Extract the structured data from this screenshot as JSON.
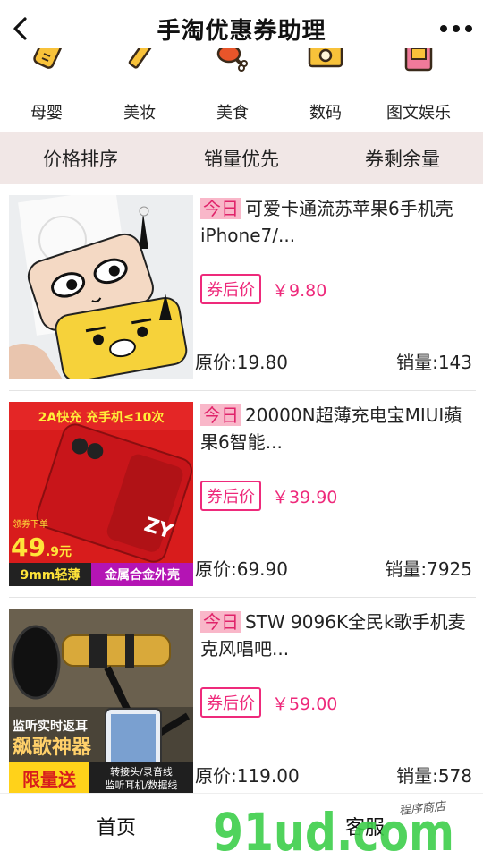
{
  "header": {
    "title": "手淘优惠券助理"
  },
  "categories": [
    {
      "label": "母婴",
      "icon": "baby-bottle-icon"
    },
    {
      "label": "美妆",
      "icon": "lipstick-icon"
    },
    {
      "label": "美食",
      "icon": "drumstick-icon"
    },
    {
      "label": "数码",
      "icon": "camera-icon"
    },
    {
      "label": "图文娱乐",
      "icon": "book-icon"
    }
  ],
  "sort": {
    "price": "价格排序",
    "sales": "销量优先",
    "coupon_left": "券剩余量"
  },
  "products": [
    {
      "today": "今日",
      "title": "可爱卡通流苏苹果6手机壳iPhone7/...",
      "coupon_label": "券后价",
      "coupon_price": "￥9.80",
      "original_price": "原价:19.80",
      "sales": "销量:143"
    },
    {
      "today": "今日",
      "title": "20000N超薄充电宝MIUI蘋果6智能...",
      "coupon_label": "券后价",
      "coupon_price": "￥39.90",
      "original_price": "原价:69.90",
      "sales": "销量:7925",
      "image_text": {
        "banner": "2A快充 充手机≤10次",
        "coupon_note": "领券下单",
        "price_big": "49",
        "price_small": ".9元",
        "feature1": "9mm轻薄",
        "feature2": "金属合金外壳",
        "logo": "ZY"
      }
    },
    {
      "today": "今日",
      "title": "STW 9096K全民k歌手机麦克风唱吧...",
      "coupon_label": "券后价",
      "coupon_price": "￥59.00",
      "original_price": "原价:119.00",
      "sales": "销量:578",
      "image_text": {
        "line1": "监听实时返耳",
        "line2": "飙歌神器",
        "gift": "限量送",
        "gift_items1": "转接头/录音线",
        "gift_items2": "监听耳机/数据线"
      }
    }
  ],
  "tabbar": {
    "home": "首页",
    "service": "客服"
  },
  "watermark": {
    "brand": "91ud.com",
    "tagline": "程序商店"
  },
  "colors": {
    "accent": "#ee2a7b",
    "today_bg": "#f9b7c9",
    "sort_bar_bg": "#f1e7e6"
  }
}
